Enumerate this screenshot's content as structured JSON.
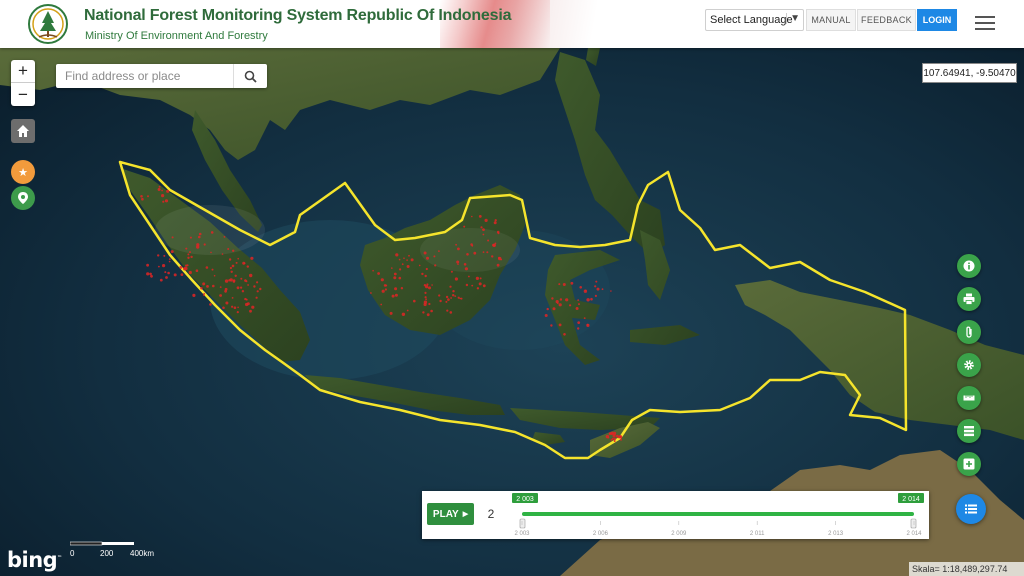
{
  "header": {
    "title": "National Forest Monitoring System Republic Of Indonesia",
    "subtitle": "Ministry Of Environment And Forestry",
    "language_label": "Select Language",
    "manual_label": "MANUAL",
    "feedback_label": "FEEDBACK",
    "login_label": "LOGIN"
  },
  "map": {
    "search_placeholder": "Find address or place",
    "coordinates": "107.64941, -9.50470",
    "zoom_in": "+",
    "zoom_out": "−",
    "scale_text": "Skala= 1:18,489,297.74",
    "scalebar": {
      "labels": [
        "0",
        "200",
        "400km"
      ]
    },
    "attribution": "bing",
    "boundary_color": "#f5e42c",
    "hotspot_color": "#e02424"
  },
  "timeline": {
    "play_label": "PLAY",
    "speed_value": "2",
    "start_year_badge": "2 003",
    "end_year_badge": "2 014",
    "ticks": [
      "2 003",
      "2 006",
      "2 009",
      "2 011",
      "2 013",
      "2 014"
    ],
    "range": [
      2003,
      2014
    ]
  },
  "tools": [
    {
      "name": "info-icon"
    },
    {
      "name": "print-icon"
    },
    {
      "name": "attachment-icon"
    },
    {
      "name": "settings-icon"
    },
    {
      "name": "ruler-icon"
    },
    {
      "name": "list-icon"
    },
    {
      "name": "add-layer-icon"
    }
  ],
  "layer_button": {
    "name": "layers-list-icon"
  }
}
